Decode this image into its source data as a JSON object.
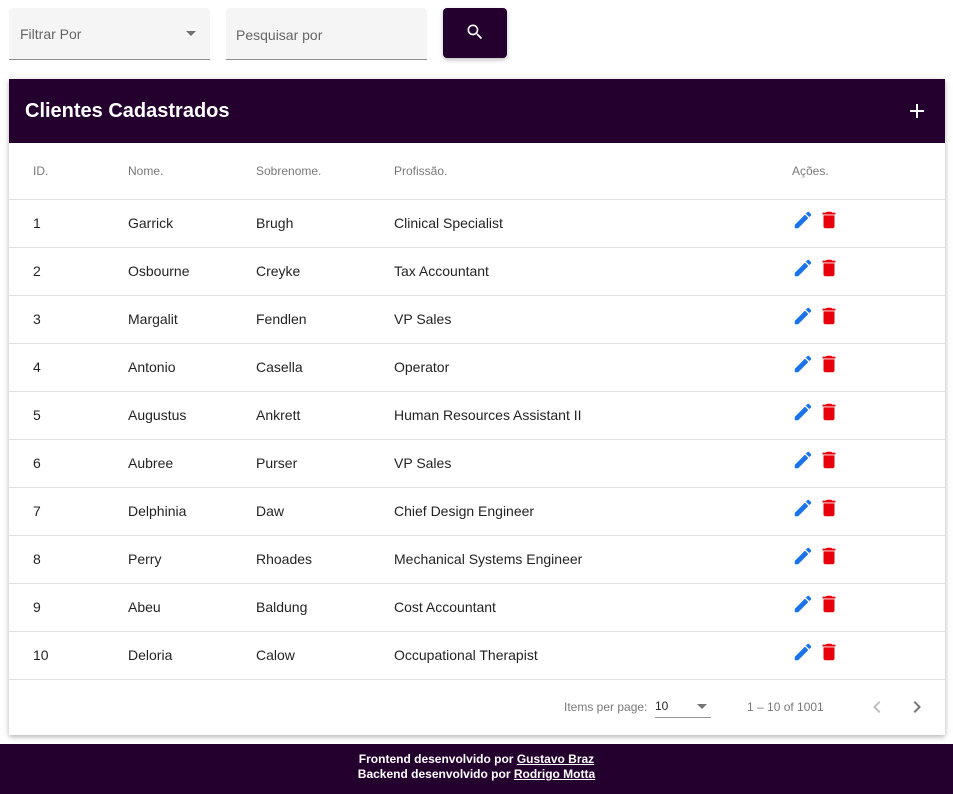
{
  "filters": {
    "filter_label": "Filtrar Por",
    "search_placeholder": "Pesquisar por",
    "search_button_icon": "search-icon"
  },
  "card": {
    "title": "Clientes Cadastrados",
    "add_icon": "plus-icon"
  },
  "table": {
    "headers": [
      "ID.",
      "Nome.",
      "Sobrenome.",
      "Profissão.",
      "Ações."
    ],
    "rows": [
      {
        "id": "1",
        "nome": "Garrick",
        "sobrenome": "Brugh",
        "profissao": "Clinical Specialist"
      },
      {
        "id": "2",
        "nome": "Osbourne",
        "sobrenome": "Creyke",
        "profissao": "Tax Accountant"
      },
      {
        "id": "3",
        "nome": "Margalit",
        "sobrenome": "Fendlen",
        "profissao": "VP Sales"
      },
      {
        "id": "4",
        "nome": "Antonio",
        "sobrenome": "Casella",
        "profissao": "Operator"
      },
      {
        "id": "5",
        "nome": "Augustus",
        "sobrenome": "Ankrett",
        "profissao": "Human Resources Assistant II"
      },
      {
        "id": "6",
        "nome": "Aubree",
        "sobrenome": "Purser",
        "profissao": "VP Sales"
      },
      {
        "id": "7",
        "nome": "Delphinia",
        "sobrenome": "Daw",
        "profissao": "Chief Design Engineer"
      },
      {
        "id": "8",
        "nome": "Perry",
        "sobrenome": "Rhoades",
        "profissao": "Mechanical Systems Engineer"
      },
      {
        "id": "9",
        "nome": "Abeu",
        "sobrenome": "Baldung",
        "profissao": "Cost Accountant"
      },
      {
        "id": "10",
        "nome": "Deloria",
        "sobrenome": "Calow",
        "profissao": "Occupational Therapist"
      }
    ]
  },
  "paginator": {
    "items_per_page_label": "Items per page:",
    "items_per_page_value": "10",
    "range_label": "1 – 10 of 1001"
  },
  "footer": {
    "frontend_prefix": "Frontend desenvolvido por",
    "frontend_author": "Gustavo Braz",
    "backend_prefix": "Backend desenvolvido por",
    "backend_author": "Rodrigo Motta"
  },
  "colors": {
    "primary": "#24002f",
    "edit_icon": "#1a73e8",
    "delete_icon": "#e8000b"
  }
}
